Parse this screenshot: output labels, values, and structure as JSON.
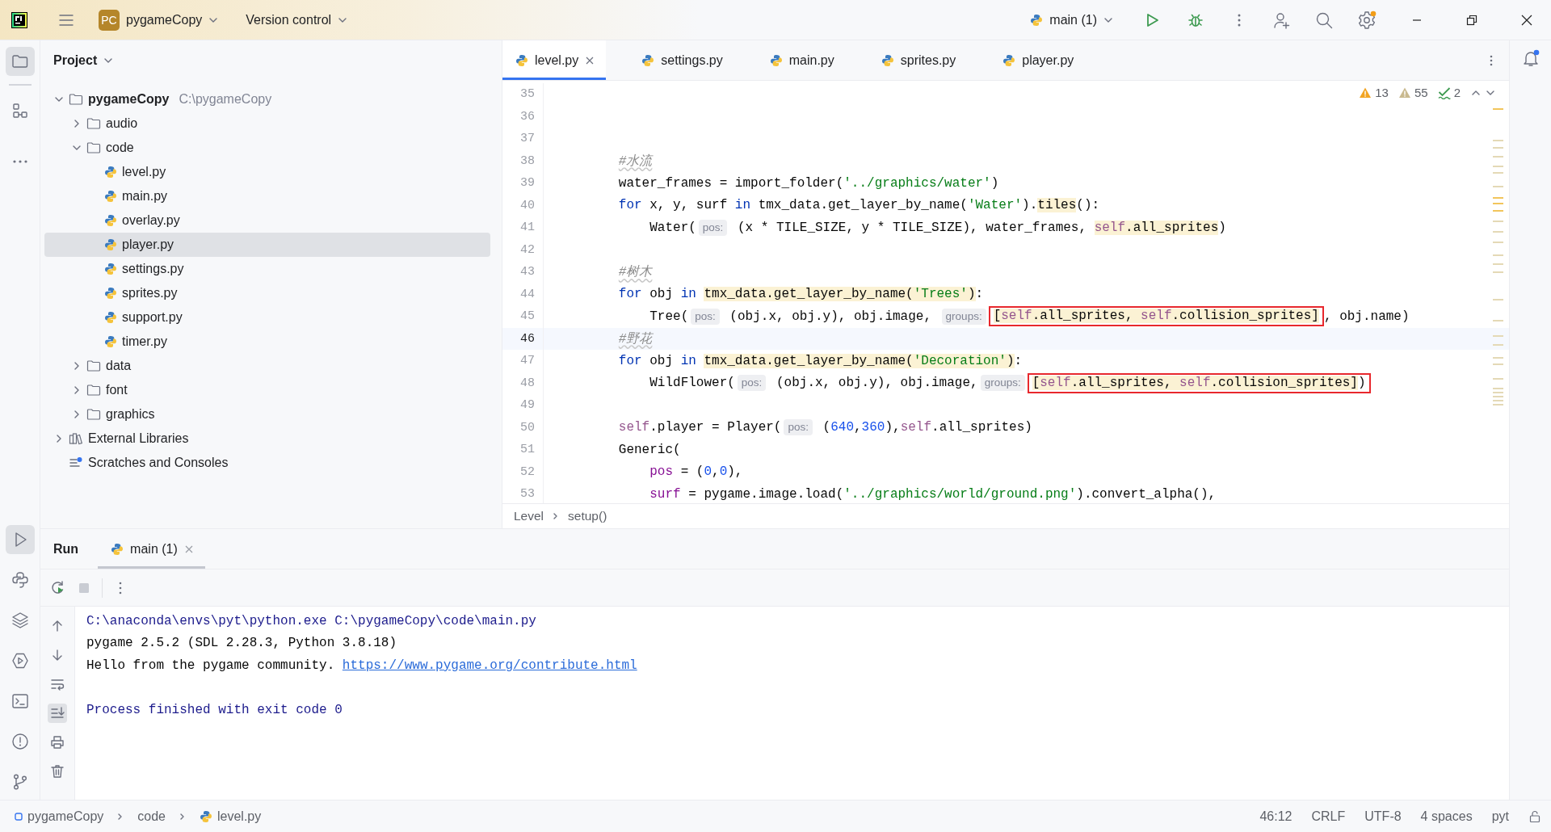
{
  "title_bar": {
    "project_badge": "PC",
    "project": "pygameCopy",
    "vcs": "Version control",
    "run_config": "main (1)"
  },
  "left_toolbar": {
    "top": [
      {
        "kind": "project",
        "selected": true
      },
      {
        "kind": "structure",
        "selected": false
      },
      {
        "kind": "more",
        "selected": false
      }
    ],
    "bottom": [
      {
        "kind": "run",
        "selected": true
      },
      {
        "kind": "python-console",
        "selected": false
      },
      {
        "kind": "layers",
        "selected": false
      },
      {
        "kind": "services",
        "selected": false
      },
      {
        "kind": "terminal",
        "selected": false
      },
      {
        "kind": "problems",
        "selected": false
      },
      {
        "kind": "git",
        "selected": false
      }
    ]
  },
  "project": {
    "title": "Project",
    "tree": [
      {
        "kind": "folder",
        "name": "pygameCopy",
        "path": "C:\\pygameCopy",
        "expanded": true,
        "selected": false,
        "children": [
          {
            "kind": "folder",
            "name": "audio",
            "expanded": false,
            "selected": false
          },
          {
            "kind": "folder",
            "name": "code",
            "expanded": true,
            "selected": false,
            "children": [
              {
                "kind": "python",
                "name": "level.py",
                "selected": false
              },
              {
                "kind": "python",
                "name": "main.py",
                "selected": false
              },
              {
                "kind": "python",
                "name": "overlay.py",
                "selected": false
              },
              {
                "kind": "python",
                "name": "player.py",
                "selected": true
              },
              {
                "kind": "python",
                "name": "settings.py",
                "selected": false
              },
              {
                "kind": "python",
                "name": "sprites.py",
                "selected": false
              },
              {
                "kind": "python",
                "name": "support.py",
                "selected": false
              },
              {
                "kind": "python",
                "name": "timer.py",
                "selected": false
              }
            ]
          },
          {
            "kind": "folder",
            "name": "data",
            "expanded": false,
            "selected": false
          },
          {
            "kind": "folder",
            "name": "font",
            "expanded": false,
            "selected": false
          },
          {
            "kind": "folder",
            "name": "graphics",
            "expanded": false,
            "selected": false
          }
        ]
      },
      {
        "kind": "library",
        "name": "External Libraries",
        "expanded": false,
        "selected": false
      },
      {
        "kind": "scratches",
        "name": "Scratches and Consoles",
        "selected": false
      }
    ]
  },
  "editor": {
    "tabs": [
      {
        "label": "level.py",
        "selected": true,
        "closable": true
      },
      {
        "label": "settings.py",
        "selected": false,
        "closable": false
      },
      {
        "label": "main.py",
        "selected": false,
        "closable": false
      },
      {
        "label": "sprites.py",
        "selected": false,
        "closable": false
      },
      {
        "label": "player.py",
        "selected": false,
        "closable": false
      }
    ],
    "inspections": {
      "warnings": "13",
      "weak_warnings": "55",
      "typos": "2"
    },
    "lines": [
      {
        "number": "35",
        "current": false,
        "kind": "blank"
      },
      {
        "number": "36",
        "current": false,
        "kind": "blank"
      },
      {
        "number": "37",
        "current": false,
        "kind": "blank"
      },
      {
        "number": "38",
        "current": false,
        "kind": "body",
        "tokens": [
          {
            "kind": "comment",
            "text": "#水流"
          }
        ]
      },
      {
        "number": "39",
        "current": false,
        "kind": "body",
        "tokens": [
          {
            "kind": "plain",
            "text": "water_frames = import_folder("
          },
          {
            "kind": "string",
            "text": "'../graphics/water'"
          },
          {
            "kind": "plain",
            "text": ")"
          }
        ]
      },
      {
        "number": "40",
        "current": false,
        "kind": "body",
        "tokens": [
          {
            "kind": "keyword",
            "text": "for"
          },
          {
            "kind": "plain",
            "text": " x, y, surf "
          },
          {
            "kind": "keyword",
            "text": "in"
          },
          {
            "kind": "plain",
            "text": " tmx_data.get_layer_by_name("
          },
          {
            "kind": "string",
            "text": "'Water'"
          },
          {
            "kind": "plain",
            "text": ")."
          },
          {
            "kind": "usage",
            "tokens": [
              {
                "kind": "plain",
                "text": "tiles"
              }
            ]
          },
          {
            "kind": "plain",
            "text": "():"
          }
        ]
      },
      {
        "number": "41",
        "current": false,
        "kind": "nested",
        "tokens": [
          {
            "kind": "plain",
            "text": "Water("
          },
          {
            "kind": "hint",
            "text": "pos:"
          },
          {
            "kind": "plain",
            "text": " (x * TILE_SIZE, y * TILE_SIZE), water_frames, "
          },
          {
            "kind": "usage",
            "tokens": [
              {
                "kind": "self",
                "text": "self"
              },
              {
                "kind": "plain",
                "text": ".all_sprites"
              }
            ]
          },
          {
            "kind": "plain",
            "text": ")"
          }
        ]
      },
      {
        "number": "42",
        "current": false,
        "kind": "blank"
      },
      {
        "number": "43",
        "current": false,
        "kind": "body",
        "tokens": [
          {
            "kind": "comment",
            "text": "#树木"
          }
        ]
      },
      {
        "number": "44",
        "current": false,
        "kind": "body",
        "tokens": [
          {
            "kind": "keyword",
            "text": "for"
          },
          {
            "kind": "plain",
            "text": " obj "
          },
          {
            "kind": "keyword",
            "text": "in "
          },
          {
            "kind": "usage",
            "tokens": [
              {
                "kind": "plain",
                "text": "tmx_data.get_layer_by_name("
              },
              {
                "kind": "string",
                "text": "'Trees'"
              },
              {
                "kind": "plain",
                "text": ")"
              }
            ]
          },
          {
            "kind": "plain",
            "text": ":"
          }
        ]
      },
      {
        "number": "45",
        "current": false,
        "kind": "nested",
        "tokens": [
          {
            "kind": "plain",
            "text": "Tree("
          },
          {
            "kind": "hint",
            "text": "pos:"
          },
          {
            "kind": "plain",
            "text": " (obj.x, obj.y), obj.image, "
          },
          {
            "kind": "hint",
            "text": "groups:"
          },
          {
            "kind": "box",
            "tokens": [
              {
                "kind": "usage",
                "tokens": [
                  {
                    "kind": "plain",
                    "text": "["
                  },
                  {
                    "kind": "self",
                    "text": "self"
                  },
                  {
                    "kind": "plain",
                    "text": ".all_sprites, "
                  },
                  {
                    "kind": "self",
                    "text": "self"
                  },
                  {
                    "kind": "plain",
                    "text": ".collision_sprites]"
                  }
                ]
              }
            ]
          },
          {
            "kind": "plain",
            "text": ", obj.name)"
          }
        ]
      },
      {
        "number": "46",
        "current": true,
        "kind": "body",
        "tokens": [
          {
            "kind": "comment",
            "text": "#野花"
          }
        ]
      },
      {
        "number": "47",
        "current": false,
        "kind": "body",
        "tokens": [
          {
            "kind": "keyword",
            "text": "for"
          },
          {
            "kind": "plain",
            "text": " obj "
          },
          {
            "kind": "keyword",
            "text": "in "
          },
          {
            "kind": "usage",
            "tokens": [
              {
                "kind": "plain",
                "text": "tmx_data.get_layer_by_name("
              },
              {
                "kind": "string",
                "text": "'Decoration'"
              },
              {
                "kind": "plain",
                "text": ")"
              }
            ]
          },
          {
            "kind": "plain",
            "text": ":"
          }
        ]
      },
      {
        "number": "48",
        "current": false,
        "kind": "nested",
        "tokens": [
          {
            "kind": "plain",
            "text": "WildFlower("
          },
          {
            "kind": "hint",
            "text": "pos:"
          },
          {
            "kind": "plain",
            "text": " (obj.x, obj.y), obj.image,"
          },
          {
            "kind": "hint",
            "text": "groups:"
          },
          {
            "kind": "box",
            "tokens": [
              {
                "kind": "usage",
                "tokens": [
                  {
                    "kind": "plain",
                    "text": "["
                  },
                  {
                    "kind": "self",
                    "text": "self"
                  },
                  {
                    "kind": "plain",
                    "text": ".all_sprites, "
                  },
                  {
                    "kind": "self",
                    "text": "self"
                  },
                  {
                    "kind": "plain",
                    "text": ".collision_sprites]"
                  }
                ]
              },
              {
                "kind": "plain",
                "text": ")"
              }
            ]
          }
        ]
      },
      {
        "number": "49",
        "current": false,
        "kind": "blank"
      },
      {
        "number": "50",
        "current": false,
        "kind": "body",
        "tokens": [
          {
            "kind": "self",
            "text": "self"
          },
          {
            "kind": "plain",
            "text": ".player = Player("
          },
          {
            "kind": "hint",
            "text": "pos:"
          },
          {
            "kind": "plain",
            "text": " ("
          },
          {
            "kind": "number",
            "text": "640"
          },
          {
            "kind": "plain",
            "text": ","
          },
          {
            "kind": "number",
            "text": "360"
          },
          {
            "kind": "plain",
            "text": "),"
          },
          {
            "kind": "self",
            "text": "self"
          },
          {
            "kind": "plain",
            "text": ".all_sprites)"
          }
        ]
      },
      {
        "number": "51",
        "current": false,
        "kind": "body",
        "tokens": [
          {
            "kind": "plain",
            "text": "Generic("
          }
        ]
      },
      {
        "number": "52",
        "current": false,
        "kind": "nested",
        "tokens": [
          {
            "kind": "param",
            "text": "pos"
          },
          {
            "kind": "plain",
            "text": " = ("
          },
          {
            "kind": "number",
            "text": "0"
          },
          {
            "kind": "plain",
            "text": ","
          },
          {
            "kind": "number",
            "text": "0"
          },
          {
            "kind": "plain",
            "text": "),"
          }
        ]
      },
      {
        "number": "53",
        "current": false,
        "kind": "nested",
        "tokens": [
          {
            "kind": "param",
            "text": "surf"
          },
          {
            "kind": "plain",
            "text": " = pygame.image.load("
          },
          {
            "kind": "string",
            "text": "'../graphics/world/ground.png'"
          },
          {
            "kind": "plain",
            "text": ").convert_alpha(),"
          }
        ]
      }
    ],
    "breadcrumbs": [
      "Level",
      "setup()"
    ]
  },
  "run_panel": {
    "title": "Run",
    "tabs": [
      {
        "label": "main (1)",
        "selected": true
      }
    ],
    "console": [
      {
        "kind": "text",
        "tokens": [
          {
            "kind": "system",
            "text": "C:\\anaconda\\envs\\pyt\\python.exe C:\\pygameCopy\\code\\main.py"
          }
        ]
      },
      {
        "kind": "text",
        "tokens": [
          {
            "kind": "output",
            "text": "pygame 2.5.2 (SDL 2.28.3, Python 3.8.18)"
          }
        ]
      },
      {
        "kind": "text",
        "tokens": [
          {
            "kind": "output",
            "text": "Hello from the pygame community. "
          },
          {
            "kind": "link",
            "text": "https://www.pygame.org/contribute.html"
          }
        ]
      },
      {
        "kind": "blank"
      },
      {
        "kind": "text",
        "tokens": [
          {
            "kind": "system",
            "text": "Process finished with exit code 0"
          }
        ]
      }
    ]
  },
  "status_bar": {
    "path": [
      {
        "kind": "module",
        "text": "pygameCopy"
      },
      {
        "kind": "folder",
        "text": "code"
      },
      {
        "kind": "python",
        "text": "level.py"
      }
    ],
    "items": [
      "46:12",
      "CRLF",
      "UTF-8",
      "4 spaces",
      "pyt"
    ]
  }
}
